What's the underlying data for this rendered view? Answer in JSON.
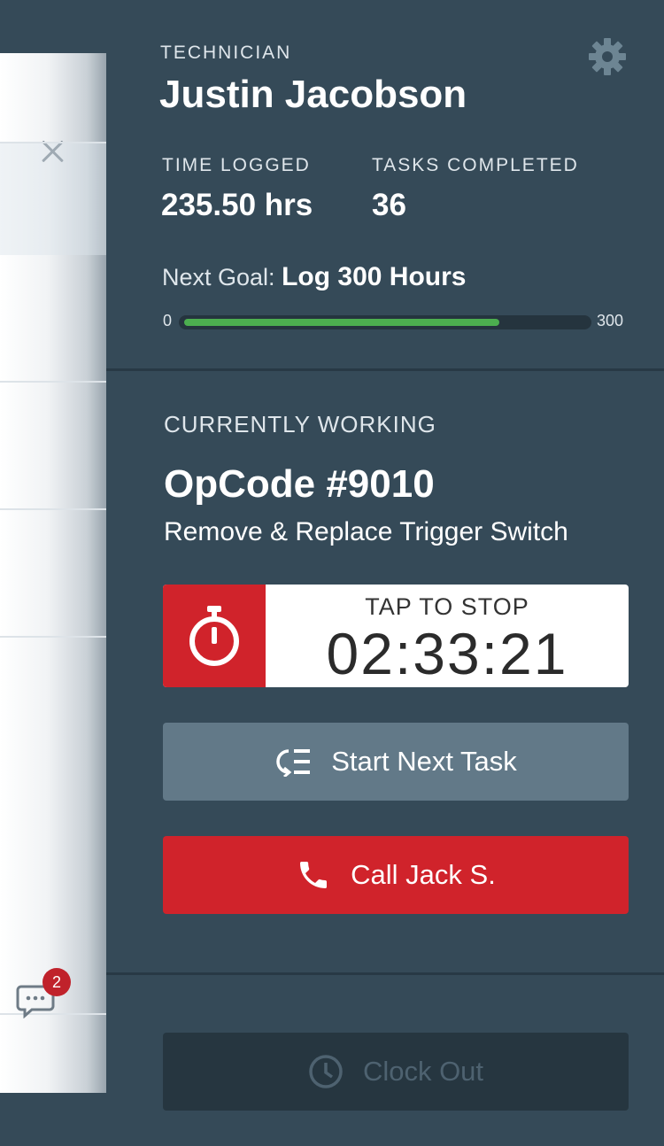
{
  "colors": {
    "background": "#354a58",
    "accent_red": "#d0232b",
    "progress_green": "#4cae4f",
    "secondary_button": "#627988",
    "disabled_button": "#263640"
  },
  "side_panel": {
    "close_icon": "close-icon",
    "chat_icon": "chat-icon",
    "chat_badge_count": "2"
  },
  "header": {
    "role_label": "TECHNICIAN",
    "name": "Justin Jacobson",
    "settings_icon": "gear-icon"
  },
  "stats": {
    "time_logged_label": "TIME LOGGED",
    "time_logged_value": "235.50 hrs",
    "tasks_completed_label": "TASKS COMPLETED",
    "tasks_completed_value": "36"
  },
  "goal": {
    "prefix": "Next Goal:",
    "value": "Log 300 Hours",
    "min_label": "0",
    "max_label": "300",
    "progress_fraction": 0.785
  },
  "current_work": {
    "section_label": "CURRENTLY WORKING",
    "opcode": "OpCode #9010",
    "description": "Remove & Replace Trigger Switch"
  },
  "timer": {
    "icon": "stopwatch-icon",
    "action_label": "TAP TO STOP",
    "elapsed": "02:33:21"
  },
  "actions": {
    "next_task_label": "Start Next Task",
    "next_task_icon": "task-list-icon",
    "call_label": "Call Jack S.",
    "call_icon": "phone-icon",
    "clock_out_label": "Clock Out",
    "clock_out_icon": "clock-icon"
  }
}
